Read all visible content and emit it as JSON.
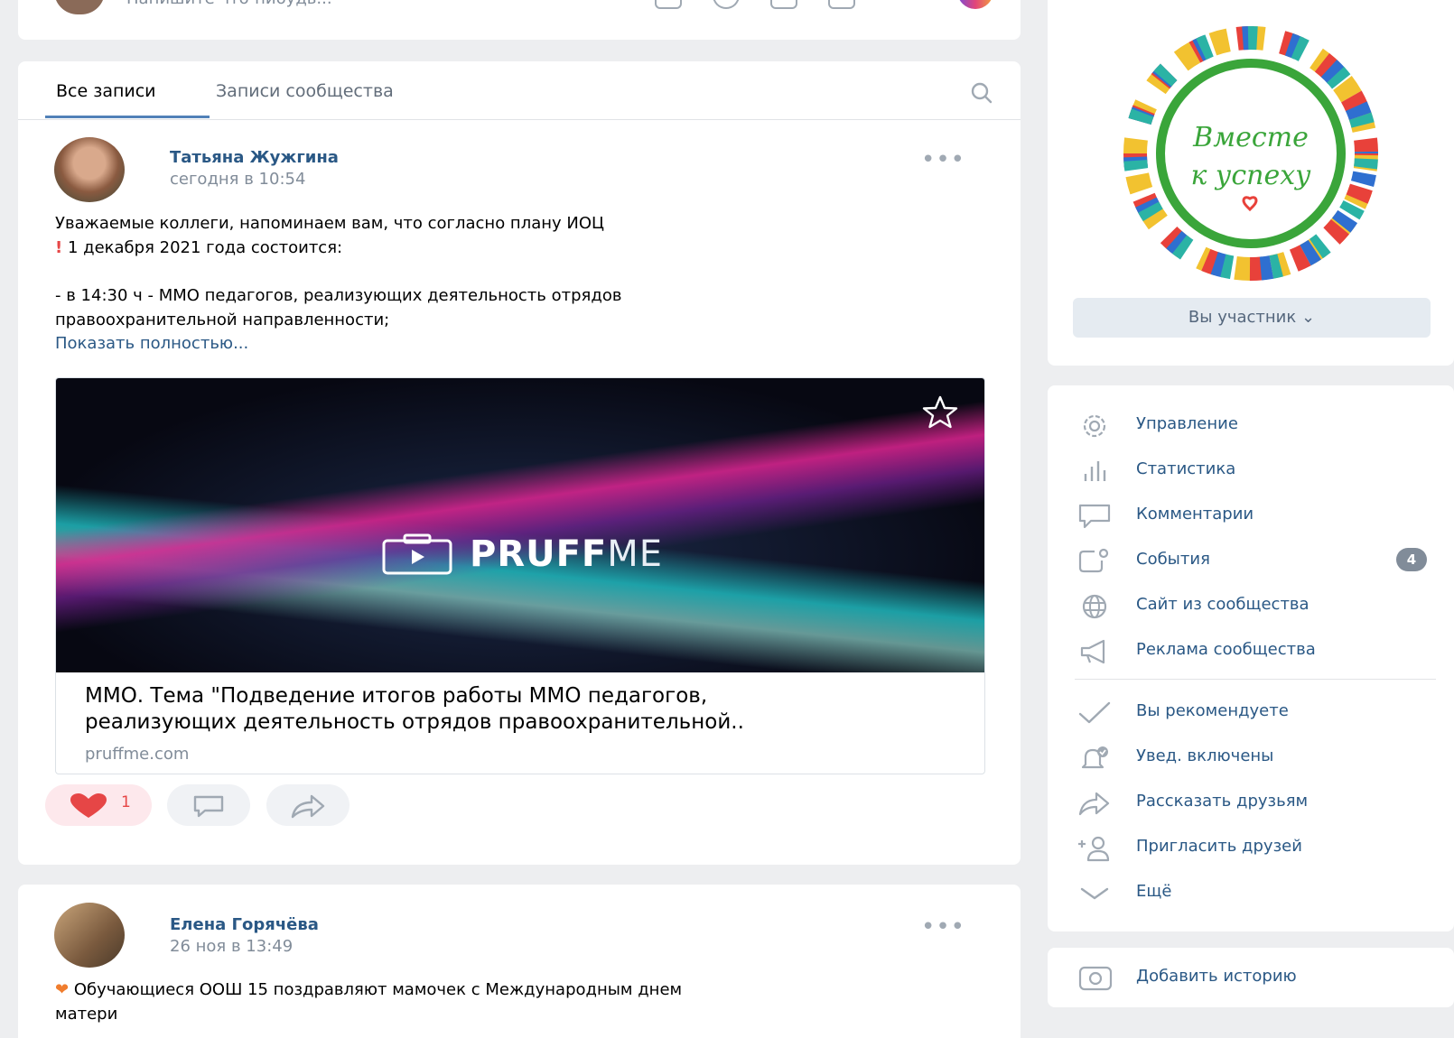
{
  "composer": {
    "placeholder": "Напишите что-нибудь..."
  },
  "wall": {
    "tabs": [
      {
        "label": "Все записи",
        "active": true
      },
      {
        "label": "Записи сообщества",
        "active": false
      }
    ]
  },
  "posts": [
    {
      "author": "Татьяна Жужгина",
      "time": "сегодня в 10:54",
      "text_lines": [
        "Уважаемые коллеги, напоминаем вам, что согласно плану ИОЦ",
        "1 декабря 2021 года состоится:",
        "- в 14:30 ч - ММО педагогов, реализующих деятельность отрядов",
        "правоохранительной направленности;"
      ],
      "show_more": "Показать полностью...",
      "link": {
        "brand_bold": "PRUFF",
        "brand_light": "ME",
        "title_line1": "ММО. Тема \"Подведение итогов работы ММО педагогов,",
        "title_line2": "реализующих деятельность отрядов правоохранительной..",
        "domain": "pruffme.com"
      },
      "likes": "1"
    },
    {
      "author": "Елена Горячёва",
      "time": "26 ноя в 13:49",
      "text_line1": "Обучающиеся   ООШ 15   поздравляют мамочек с Международным днем",
      "text_line2": "матери"
    }
  ],
  "cover": {
    "logo_line1": "Вместе",
    "logo_line2": "к успеху",
    "member_button": "Вы участник"
  },
  "menu": {
    "items": [
      {
        "label": "Управление",
        "icon": "gear-icon"
      },
      {
        "label": "Статистика",
        "icon": "stats-icon"
      },
      {
        "label": "Комментарии",
        "icon": "comment-icon"
      },
      {
        "label": "События",
        "icon": "events-icon",
        "badge": "4"
      },
      {
        "label": "Сайт из сообщества",
        "icon": "globe-icon"
      },
      {
        "label": "Реклама сообщества",
        "icon": "megaphone-icon"
      },
      {
        "label": "Вы рекомендуете",
        "icon": "check-icon"
      },
      {
        "label": "Увед. включены",
        "icon": "bell-icon"
      },
      {
        "label": "Рассказать друзьям",
        "icon": "share-icon"
      },
      {
        "label": "Пригласить друзей",
        "icon": "add-user-icon"
      },
      {
        "label": "Ещё",
        "icon": "chevron-down-icon"
      }
    ]
  },
  "history": {
    "label": "Добавить историю"
  },
  "colors": {
    "accent": "#2a5885",
    "tab_underline": "#5181b8",
    "like": "#e64646",
    "page_bg": "#edeef0"
  }
}
